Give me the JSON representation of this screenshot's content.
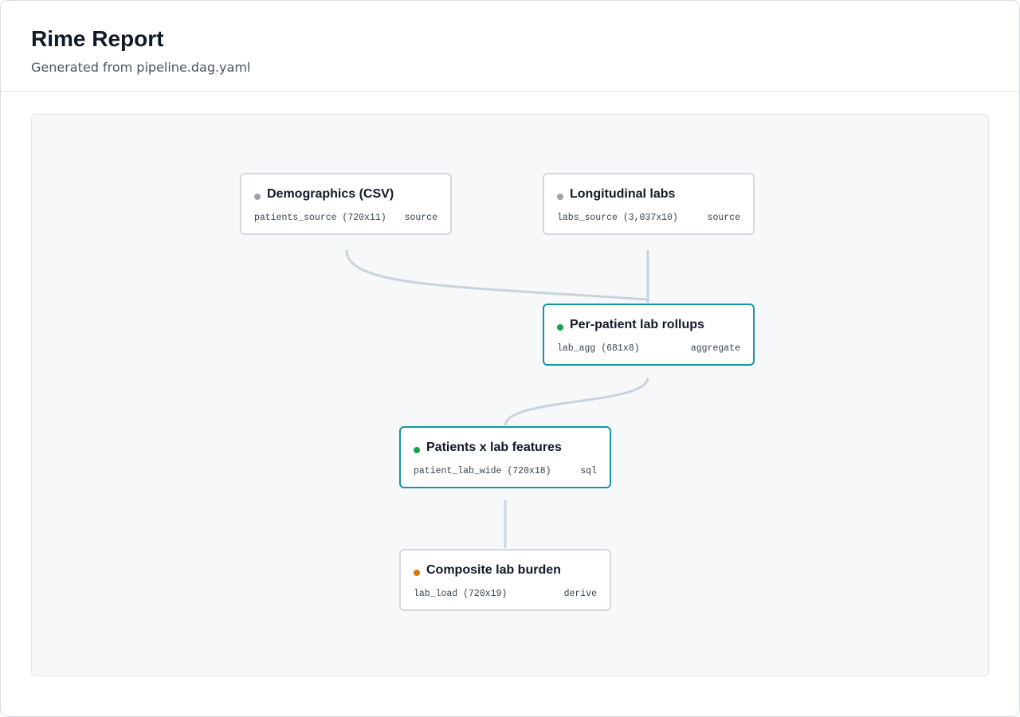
{
  "header": {
    "title": "Rime Report",
    "subtitle": "Generated from pipeline.dag.yaml"
  },
  "colors": {
    "source_dot": "#9ca3af",
    "active_dot": "#16a34a",
    "derive_dot": "#d97706",
    "active_border": "#1496a4",
    "edge": "#c9d3dd"
  },
  "nodes": [
    {
      "title": "Demographics (CSV)",
      "id_text": "patients_source (720x11)",
      "kind": "source",
      "status": "source"
    },
    {
      "title": "Longitudinal labs",
      "id_text": "labs_source (3,037x10)",
      "kind": "source",
      "status": "source"
    },
    {
      "title": "Per-patient lab rollups",
      "id_text": "lab_agg (681x8)",
      "kind": "aggregate",
      "status": "active"
    },
    {
      "title": "Patients x lab features",
      "id_text": "patient_lab_wide (720x18)",
      "kind": "sql",
      "status": "active"
    },
    {
      "title": "Composite lab burden",
      "id_text": "lab_load (720x19)",
      "kind": "derive",
      "status": "derive"
    }
  ]
}
